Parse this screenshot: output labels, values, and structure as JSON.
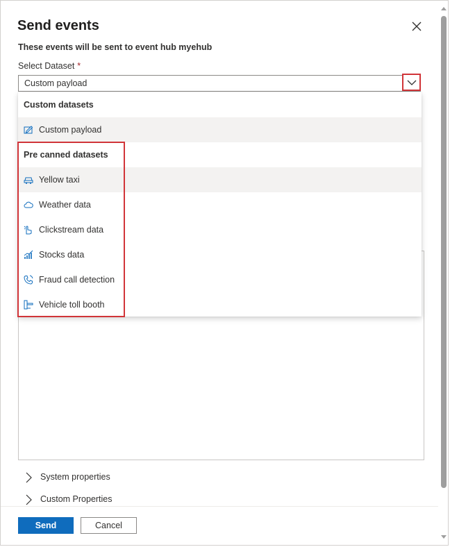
{
  "panel": {
    "title": "Send events",
    "subtitle": "These events will be sent to event hub myehub",
    "close_icon": "close-icon"
  },
  "dataset_field": {
    "label": "Select Dataset",
    "required_marker": "*",
    "value": "Custom payload",
    "chevron_icon": "chevron-down-icon"
  },
  "dropdown": {
    "groups": [
      {
        "header": "Custom datasets",
        "options": [
          {
            "label": "Custom payload",
            "icon": "edit-icon",
            "selected": true
          }
        ]
      },
      {
        "header": "Pre canned datasets",
        "options": [
          {
            "label": "Yellow taxi",
            "icon": "car-icon",
            "selected": false
          },
          {
            "label": "Weather data",
            "icon": "cloud-icon",
            "selected": false
          },
          {
            "label": "Clickstream data",
            "icon": "pointer-hand-icon",
            "selected": false
          },
          {
            "label": "Stocks data",
            "icon": "stock-chart-icon",
            "selected": false
          },
          {
            "label": "Fraud call detection",
            "icon": "phone-icon",
            "selected": false
          },
          {
            "label": "Vehicle toll booth",
            "icon": "toll-booth-icon",
            "selected": false
          }
        ]
      }
    ]
  },
  "expanders": {
    "system": "System properties",
    "custom": "Custom Properties",
    "icon": "chevron-right-icon"
  },
  "footer": {
    "send_label": "Send",
    "cancel_label": "Cancel"
  },
  "colors": {
    "accent": "#0f6cbd",
    "highlight": "#d13438",
    "required": "#a4262c",
    "selected_bg": "#f3f2f1"
  }
}
